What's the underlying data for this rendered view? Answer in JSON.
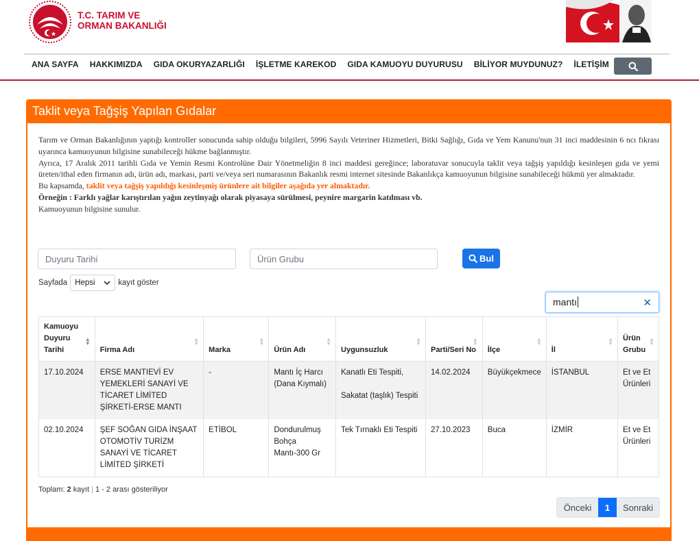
{
  "header": {
    "logo_text_line1": "T.C. TARIM VE",
    "logo_text_line2": "ORMAN BAKANLIĞI"
  },
  "nav": [
    "ANA SAYFA",
    "HAKKIMIZDA",
    "GIDA OKURYAZARLIĞI",
    "İŞLETME KAREKOD",
    "GIDA KAMUOYU DUYURUSU",
    "BİLİYOR MUYDUNUZ?",
    "İLETİŞİM"
  ],
  "card": {
    "title": "Taklit veya Tağşiş Yapılan Gıdalar",
    "intro_p1": "Tarım ve Orman Bakanlığının yaptığı kontroller sonucunda sahip olduğu bilgileri, 5996 Sayılı Veteriner Hizmetleri, Bitki Sağlığı, Gıda ve Yem Kanunu'nun 31 inci maddesinin 6 ncı fıkrası uyarınca kamuoyunun bilgisine sunabileceği hükme bağlanmıştır.",
    "intro_p2": "Ayrıca, 17 Aralık 2011 tarihli Gıda ve Yemin Resmi Kontrolüne Dair Yönetmeliğin 8 inci maddesi gereğince; laboratuvar sonucuyla taklit veya tağşiş yapıldığı kesinleşen gıda ve yemi üreten/ithal eden firmanın adı, ürün adı, markası, parti ve/veya seri numarasının Bakanlık resmi internet sitesinde Bakanlıkça kamuoyunun bilgisine sunabileceği hükmü yer almaktadır.",
    "intro_p3_prefix": "Bu kapsamda, ",
    "intro_p3_highlight": "taklit veya tağşiş yapıldığı kesinleşmiş ürünlere ait bilgiler aşağıda yer almaktadır.",
    "intro_p4": "Örneğin : Farklı yağlar karıştırılan yağın zeytinyağı olarak piyasaya sürülmesi, peynire margarin katılması vb.",
    "intro_p5": "Kamuoyunun bilgisine sunulur."
  },
  "filters": {
    "date_placeholder": "Duyuru Tarihi",
    "group_placeholder": "Ürün Grubu",
    "search_button": "Bul",
    "page_size_prefix": "Sayfada",
    "page_size_value": "Hepsi",
    "page_size_suffix": "kayıt göster",
    "table_search_value": "mantı"
  },
  "table": {
    "headers": [
      "Kamuoyu Duyuru Tarihi",
      "Firma Adı",
      "Marka",
      "Ürün Adı",
      "Uygunsuzluk",
      "Parti/Seri No",
      "İlçe",
      "İl",
      "Ürün Grubu"
    ],
    "rows": [
      {
        "date": "17.10.2024",
        "firm": "ERSE MANTIEVİ EV YEMEKLERİ SANAYİ VE TİCARET LİMİTED ŞİRKETİ-ERSE MANTI",
        "brand": "-",
        "product": "Mantı İç Harcı (Dana Kıymalı)",
        "issue1": "Kanatlı Eti Tespiti,",
        "issue2": "Sakatat (taşlık) Tespiti",
        "lot": "14.02.2024",
        "district": "Büyükçekmece",
        "city": "İSTANBUL",
        "group": "Et ve Et Ürünleri"
      },
      {
        "date": "02.10.2024",
        "firm": "ŞEF SOĞAN GIDA İNŞAAT OTOMOTİV TURİZM SANAYİ VE TİCARET LİMİTED ŞİRKETİ",
        "brand": "ETİBOL",
        "product": "Dondurulmuş Bohça Mantı-300 Gr",
        "issue1": "Tek Tırnaklı Eti Tespiti",
        "issue2": "",
        "lot": "27.10.2023",
        "district": "Buca",
        "city": "İZMİR",
        "group": "Et ve Et Ürünleri"
      }
    ]
  },
  "footer": {
    "total_prefix": "Toplam:",
    "total_count": "2",
    "total_unit": "kayıt",
    "range_text": "1 - 2 arası gösteriliyor",
    "prev": "Önceki",
    "current_page": "1",
    "next": "Sonraki"
  },
  "colors": {
    "accent": "#ff6b00",
    "brand_red": "#c8102e",
    "primary_blue": "#1a73e8"
  }
}
